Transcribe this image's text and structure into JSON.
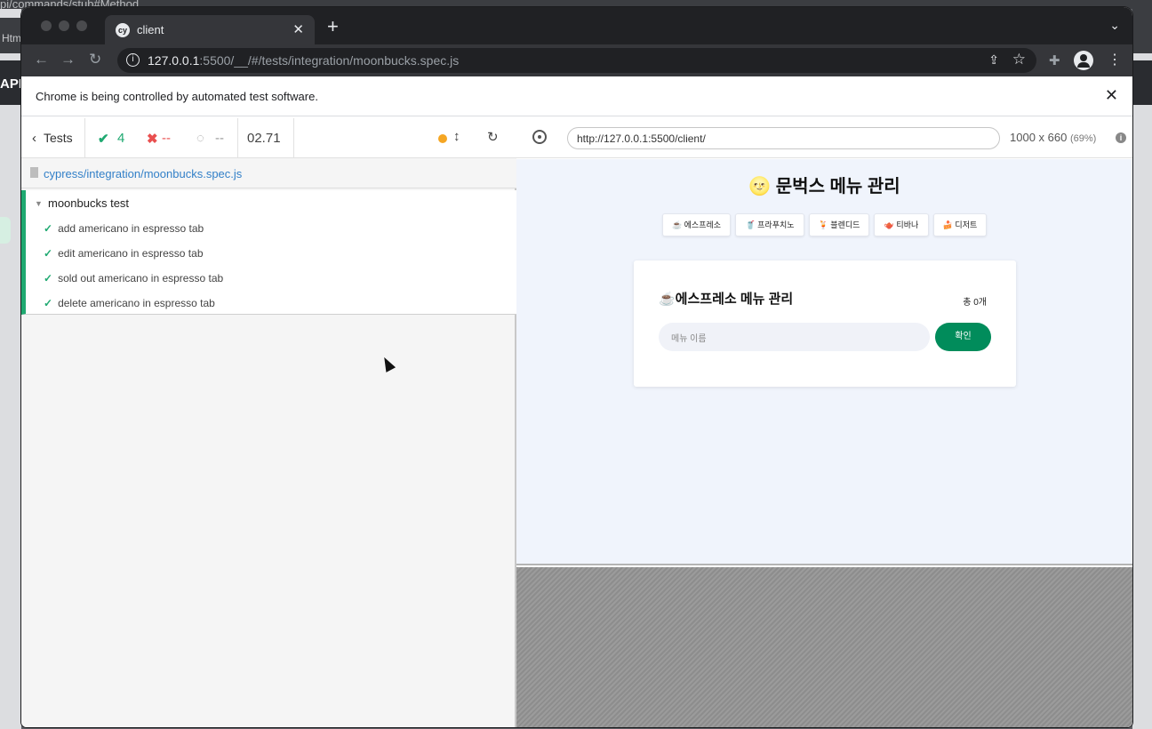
{
  "background": {
    "top_text": "pi/commands/stub#Method",
    "left_tab_text": "Htm",
    "left_label": "API"
  },
  "browser": {
    "tab_title": "client",
    "tab_favicon": "cy",
    "url_host": "127.0.0.1",
    "url_rest": ":5500/__/#/tests/integration/moonbucks.spec.js",
    "infobar_message": "Chrome is being controlled by automated test software."
  },
  "reporter": {
    "back_label": "Tests",
    "passed": "4",
    "failed": "--",
    "pending": "--",
    "duration": "02.71",
    "spec_path": "cypress/integration/moonbucks.spec.js",
    "suite_name": "moonbucks test",
    "tests": [
      {
        "title": "add americano in espresso tab",
        "state": "passed"
      },
      {
        "title": "edit americano in espresso tab",
        "state": "passed"
      },
      {
        "title": "sold out americano in espresso tab",
        "state": "passed"
      },
      {
        "title": "delete americano in espresso tab",
        "state": "passed"
      }
    ]
  },
  "runner": {
    "aut_url": "http://127.0.0.1:5500/client/",
    "viewport": "1000 x 660",
    "scale": "(69%)"
  },
  "app": {
    "title": "🌝 문벅스 메뉴 관리",
    "categories": [
      {
        "label": "☕ 에스프레소"
      },
      {
        "label": "🥤 프라푸치노"
      },
      {
        "label": "🍹 블렌디드"
      },
      {
        "label": "🫖 티바나"
      },
      {
        "label": "🍰 디저트"
      }
    ],
    "section_title": "☕에스프레소 메뉴 관리",
    "count_label": "총 0개",
    "input_placeholder": "메뉴 이름",
    "submit_label": "확인"
  },
  "colors": {
    "pass_green": "#1fa971",
    "fail_red": "#e94f4f",
    "link_blue": "#3380c8",
    "submit_green": "#018c5b",
    "pending_dot": "#f5a623"
  }
}
